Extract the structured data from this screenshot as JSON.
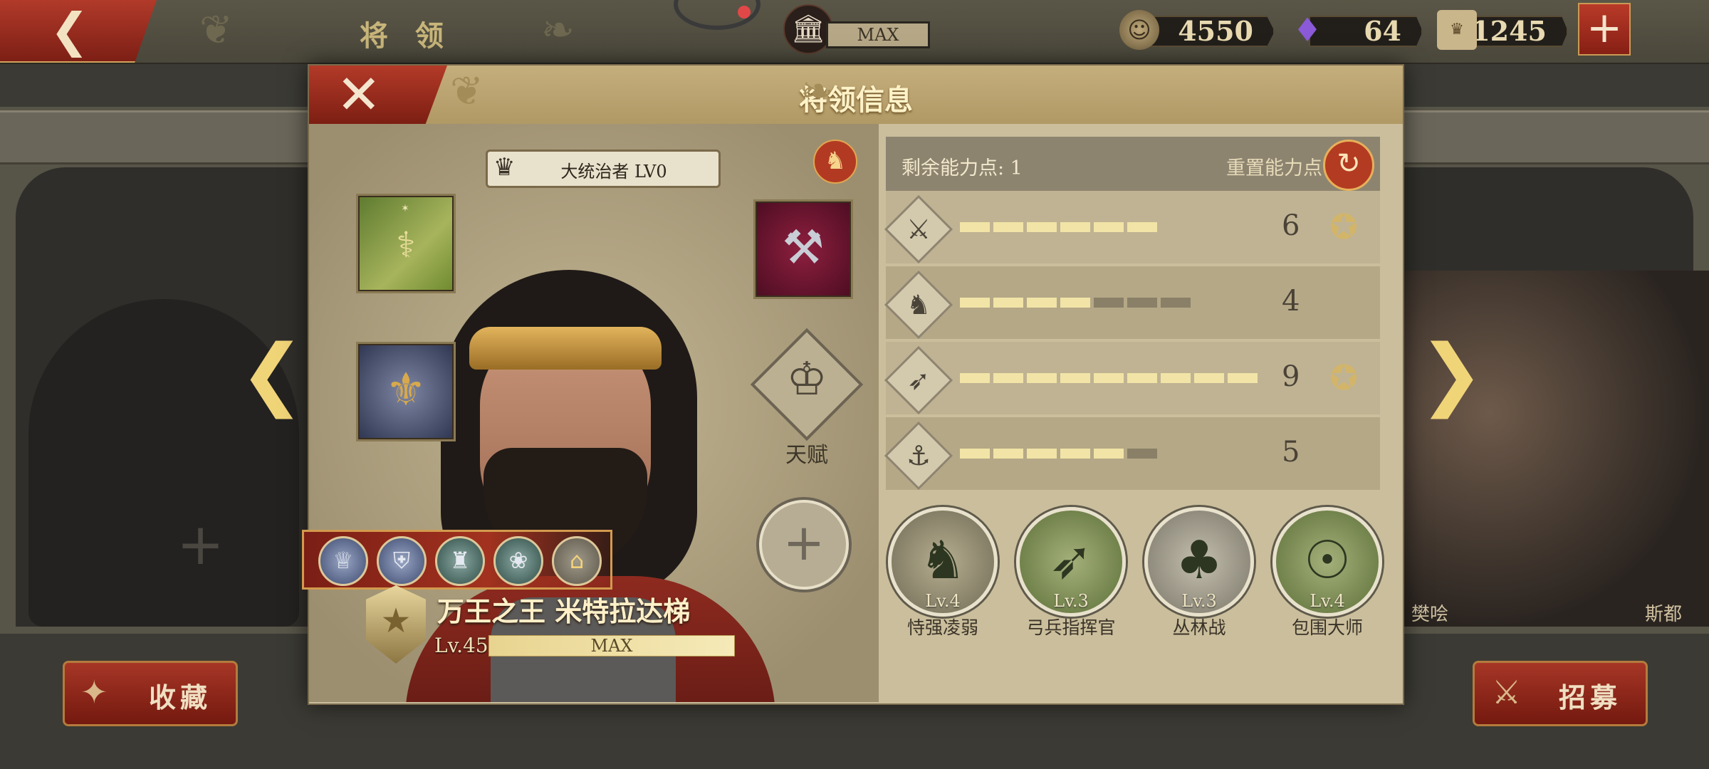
{
  "topbar": {
    "back_icon": "back-arrow-icon",
    "title": "将 领",
    "museum_value": "MAX",
    "resources": [
      {
        "name": "coin",
        "icon": "coin-icon",
        "value": "4550"
      },
      {
        "name": "gem",
        "icon": "purple-gem-icon",
        "value": "64"
      },
      {
        "name": "spqr",
        "icon": "spqr-ticket-icon",
        "value": "1245"
      }
    ],
    "plus_icon": "plus-icon"
  },
  "background": {
    "side_names": [
      "樊哙",
      "斯都"
    ],
    "favorite_label": "收藏",
    "recruit_label": "招募"
  },
  "dialog": {
    "title": "将领信息",
    "title_badge": "大统治者 LV0",
    "talent_label": "天赋",
    "hero": {
      "name": "万王之王 米特拉达梯",
      "level": "Lv.45",
      "xp_text": "MAX",
      "xp_fraction": 1.0
    },
    "skill_coins": [
      "eagle-emblem-icon",
      "shield-emblem-icon",
      "helmet-emblem-icon",
      "laurel-emblem-icon",
      "lock-icon"
    ],
    "points": {
      "label": "剩余能力点: 1",
      "reset_label": "重置能力点"
    },
    "stats": [
      {
        "icon": "sword-icon",
        "value": "6",
        "filled": 6,
        "total": 6,
        "medal": true
      },
      {
        "icon": "horse-icon",
        "value": "4",
        "filled": 4,
        "total": 7,
        "medal": false
      },
      {
        "icon": "bow-icon",
        "value": "9",
        "filled": 9,
        "total": 9,
        "medal": true
      },
      {
        "icon": "anchor-icon",
        "value": "5",
        "filled": 5,
        "total": 6,
        "medal": false
      }
    ],
    "skills": [
      {
        "level": "Lv.4",
        "name": "恃强凌弱",
        "icon": "cavalry-icon"
      },
      {
        "level": "Lv.3",
        "name": "弓兵指挥官",
        "icon": "bow-icon"
      },
      {
        "level": "Lv.3",
        "name": "丛林战",
        "icon": "forest-icon"
      },
      {
        "level": "Lv.4",
        "name": "包围大师",
        "icon": "encircle-icon"
      }
    ],
    "colors": {
      "bar_filled": "#f1e4a6",
      "bar_empty": "#8a8068",
      "accent_red": "#b33a28"
    }
  }
}
